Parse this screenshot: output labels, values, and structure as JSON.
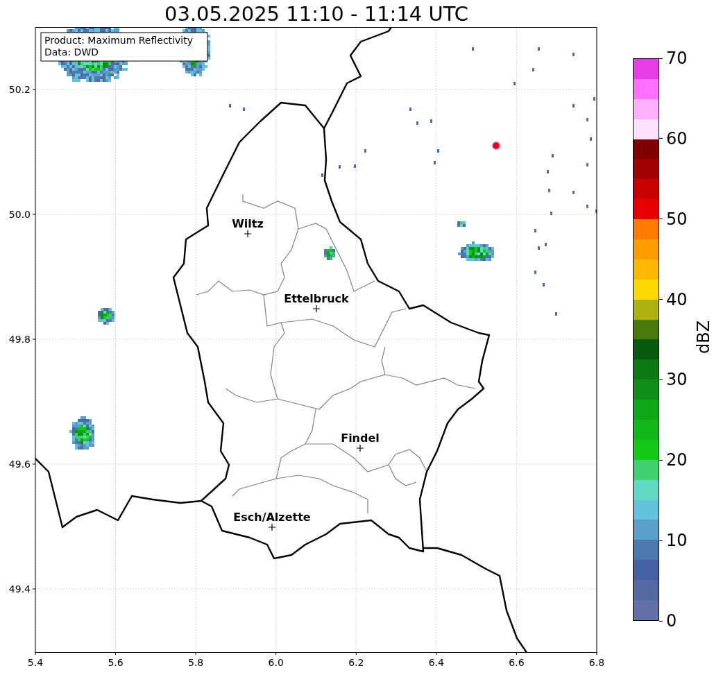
{
  "title": "03.05.2025 11:10 - 11:14 UTC",
  "legend": {
    "lines": [
      "Product: Maximum Reflectivity",
      "Data: DWD"
    ]
  },
  "map": {
    "x_ticks": [
      "5.4",
      "5.6",
      "5.8",
      "6.0",
      "6.2",
      "6.4",
      "6.6",
      "6.8"
    ],
    "y_ticks": [
      "50.2",
      "50.0",
      "49.8",
      "49.6",
      "49.4"
    ],
    "places": [
      "Wiltz",
      "Ettelbruck",
      "Findel",
      "Esch/Alzette"
    ]
  },
  "colorbar": {
    "label": "dBZ",
    "ticks": [
      "70",
      "60",
      "50",
      "40",
      "30",
      "20",
      "10",
      "0"
    ],
    "segments": [
      {
        "color": "#e83ce8"
      },
      {
        "color": "#ff70ff"
      },
      {
        "color": "#ffb0ff"
      },
      {
        "color": "#ffe0ff"
      },
      {
        "color": "#800000"
      },
      {
        "color": "#a00000"
      },
      {
        "color": "#c80000"
      },
      {
        "color": "#e80000"
      },
      {
        "color": "#ff7c00"
      },
      {
        "color": "#ff9c00"
      },
      {
        "color": "#ffb800"
      },
      {
        "color": "#ffd800"
      },
      {
        "color": "#acb010"
      },
      {
        "color": "#4a7a0c"
      },
      {
        "color": "#085a0c"
      },
      {
        "color": "#0c7a14"
      },
      {
        "color": "#0e9018"
      },
      {
        "color": "#10a818"
      },
      {
        "color": "#12b818"
      },
      {
        "color": "#14c818"
      },
      {
        "color": "#40d070"
      },
      {
        "color": "#60d8c4"
      },
      {
        "color": "#62c2dc"
      },
      {
        "color": "#58a0c8"
      },
      {
        "color": "#4c7ab0"
      },
      {
        "color": "#4560a4"
      },
      {
        "color": "#5468a2"
      },
      {
        "color": "#6170a6"
      }
    ]
  }
}
